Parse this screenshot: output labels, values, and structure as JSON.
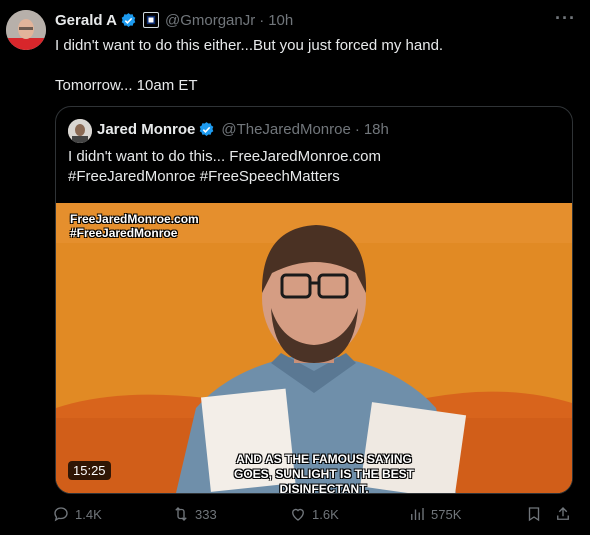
{
  "tweet": {
    "author_name": "Gerald A",
    "handle": "@GmorganJr",
    "separator": "·",
    "time": "10h",
    "more_label": "···",
    "text_line1": "I didn't want to do this either...But you just forced my hand.",
    "text_line2": "Tomorrow... 10am ET"
  },
  "quoted": {
    "author_name": "Jared Monroe",
    "handle": "@TheJaredMonroe",
    "separator": "·",
    "time": "18h",
    "text_line1": "I didn't want to do this...  FreeJaredMonroe.com",
    "text_line2": "#FreeJaredMonroe #FreeSpeechMatters",
    "video": {
      "overlay_line1": "FreeJaredMonroe.com",
      "overlay_line2": "#FreeJaredMonroe",
      "caption_line1": "AND AS THE FAMOUS SAYING",
      "caption_line2": "GOES, SUNLIGHT IS THE BEST DISINFECTANT.",
      "duration": "15:25"
    }
  },
  "actions": {
    "replies": "1.4K",
    "retweets": "333",
    "likes": "1.6K",
    "views": "575K"
  },
  "colors": {
    "background": "#000000",
    "text": "#e7e9ea",
    "muted": "#71767b",
    "verified": "#1d9bf0",
    "video_bg": "#e18a24"
  },
  "icons": [
    "verified-badge-icon",
    "affiliate-badge-icon",
    "more-icon",
    "reply-icon",
    "retweet-icon",
    "like-icon",
    "views-icon",
    "bookmark-icon",
    "share-icon"
  ]
}
